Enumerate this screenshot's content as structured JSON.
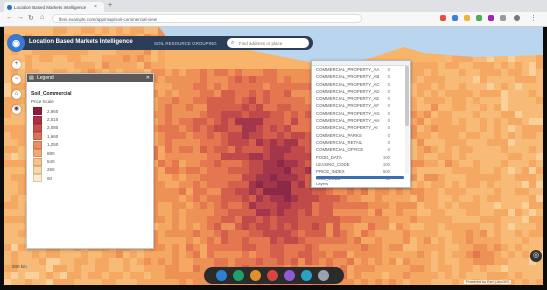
{
  "browser": {
    "tab_title": "Location Based Markets Intelligence",
    "url": "lbmi.example.com/app/map/soil-commercial-view",
    "new_tab_label": "+",
    "close_label": "×"
  },
  "app": {
    "title": "Location Based Markets Intelligence",
    "subtitle": "SOIL RESOURCE GROUPING",
    "search_placeholder": "Find address or place"
  },
  "map_controls": [
    "+",
    "−",
    "⌂",
    "◉"
  ],
  "legend": {
    "header": "Legend",
    "title": "Soil_Commercial",
    "subtitle": "Price Scale",
    "items": [
      {
        "label": "2,960",
        "color": "#8e1d3b"
      },
      {
        "label": "2,510",
        "color": "#b02f44"
      },
      {
        "label": "2,080",
        "color": "#cb4e4c"
      },
      {
        "label": "1,660",
        "color": "#e0705a"
      },
      {
        "label": "1,250",
        "color": "#eb8e66"
      },
      {
        "label": "880",
        "color": "#f2a873"
      },
      {
        "label": "540",
        "color": "#f6c18a"
      },
      {
        "label": "260",
        "color": "#f9d8a8"
      },
      {
        "label": "60",
        "color": "#fcebcf"
      }
    ]
  },
  "layers": {
    "items": [
      {
        "name": "COMMERCIAL_PROPERTY_AA",
        "value": "0"
      },
      {
        "name": "COMMERCIAL_PROPERTY_AB",
        "value": "0"
      },
      {
        "name": "COMMERCIAL_PROPERTY_AC",
        "value": "0"
      },
      {
        "name": "COMMERCIAL_PROPERTY_AD",
        "value": "0"
      },
      {
        "name": "COMMERCIAL_PROPERTY_AE",
        "value": "0"
      },
      {
        "name": "COMMERCIAL_PROPERTY_AF",
        "value": "0"
      },
      {
        "name": "COMMERCIAL_PROPERTY_AG",
        "value": "0"
      },
      {
        "name": "COMMERCIAL_PROPERTY_AH",
        "value": "0"
      },
      {
        "name": "COMMERCIAL_PROPERTY_AI",
        "value": "0"
      },
      {
        "name": "COMMERCIAL_PARKS",
        "value": "0"
      },
      {
        "name": "COMMERCIAL_RETAIL",
        "value": "0"
      },
      {
        "name": "COMMERCIAL_OFFICE",
        "value": "0"
      },
      {
        "name": "FOOD_DATA",
        "value": "100"
      },
      {
        "name": "LEASING_CODE",
        "value": "100"
      },
      {
        "name": "PRICE_INDEX",
        "value": "500"
      },
      {
        "name": "SOIL_CODE",
        "value": "10"
      }
    ],
    "footer": "Layers"
  },
  "dock_colors": [
    "#2f80d1",
    "#22a06b",
    "#e0902a",
    "#d64541",
    "#8e5bd0",
    "#27a3c6",
    "#9aa3ad"
  ],
  "zoom_scale": "500 km",
  "attribution": "Powered by Esri | ArcGIS"
}
